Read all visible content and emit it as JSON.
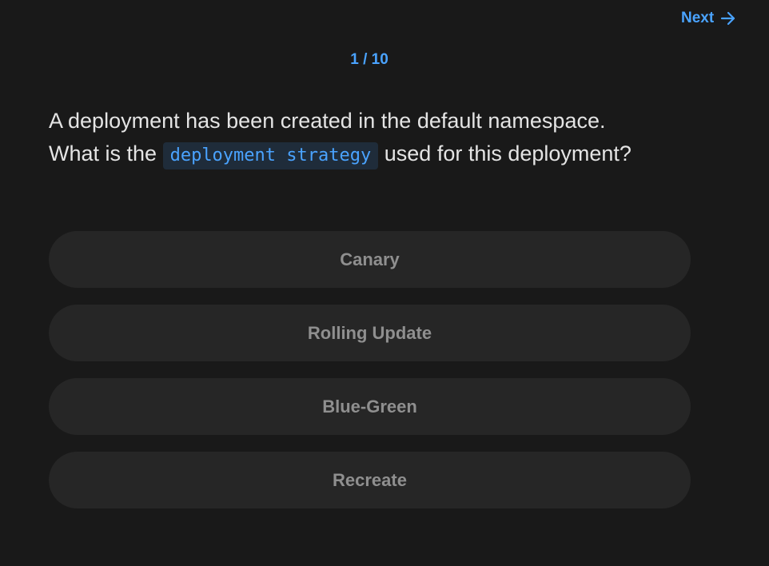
{
  "nav": {
    "next_label": "Next"
  },
  "quiz": {
    "progress": "1 / 10",
    "question": {
      "line1": "A deployment has been created in the default namespace.",
      "line2_before": "What is the",
      "code": "deployment strategy",
      "line2_after": "used for this deployment?"
    },
    "options": [
      {
        "label": "Canary"
      },
      {
        "label": "Rolling Update"
      },
      {
        "label": "Blue-Green"
      },
      {
        "label": "Recreate"
      }
    ]
  },
  "icons": {
    "next": "arrow-right-icon"
  },
  "colors": {
    "background": "#191919",
    "accent": "#4aa3ff",
    "option_bg": "#262626",
    "option_text": "#8f8f8f",
    "code_bg": "#1f2c3a"
  }
}
